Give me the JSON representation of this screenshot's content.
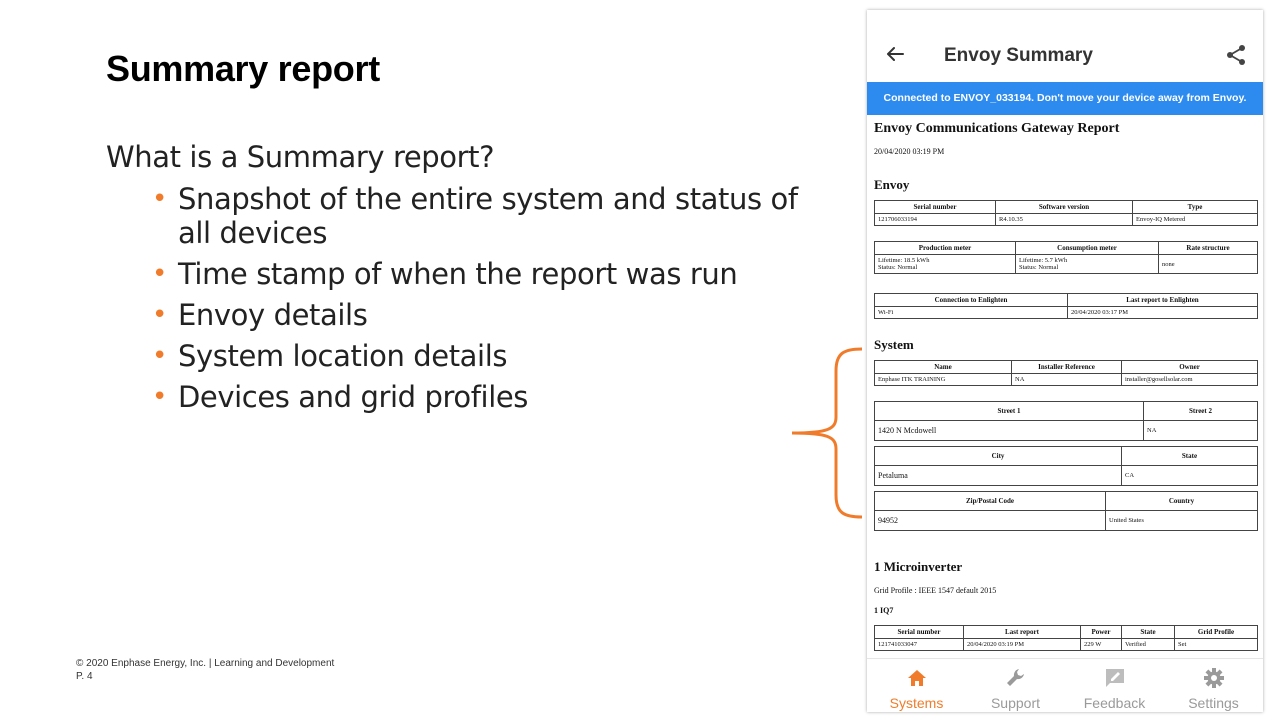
{
  "slide": {
    "title": "Summary report",
    "question": "What is a Summary report?",
    "bullets": [
      "Snapshot of the entire system and status of all devices",
      "Time stamp of when the report was run",
      "Envoy details",
      "System location details",
      "Devices and grid profiles"
    ],
    "footer_line1": "© 2020 Enphase Energy, Inc. | Learning and Development",
    "footer_line2": "P. 4",
    "colors": {
      "accent": "#f07c2b",
      "banner": "#2d8bf0"
    }
  },
  "app": {
    "title": "Envoy Summary",
    "back_icon": "arrow-left-icon",
    "share_icon": "share-icon",
    "banner": "Connected to ENVOY_033194. Don't move your device away from Envoy.",
    "report": {
      "title": "Envoy Communications Gateway Report",
      "date": "20/04/2020 03:19 PM",
      "envoy_heading": "Envoy",
      "envoy_table": {
        "headers": [
          "Serial number",
          "Software version",
          "Type"
        ],
        "row": [
          "121706033194",
          "R4.10.35",
          "Envoy-IQ Metered"
        ]
      },
      "meter_table": {
        "headers": [
          "Production meter",
          "Consumption meter",
          "Rate structure"
        ],
        "prod_l1": "Lifetime: 18.5 kWh",
        "prod_l2": "Status: Normal",
        "cons_l1": "Lifetime: 5.7 kWh",
        "cons_l2": "Status: Normal",
        "rate": "none"
      },
      "conn_table": {
        "headers": [
          "Connection to Enlighten",
          "Last report to Enlighten"
        ],
        "row": [
          "Wi-Fi",
          "20/04/2020 03:17 PM"
        ]
      },
      "system_heading": "System",
      "system_table": {
        "headers": [
          "Name",
          "Installer Reference",
          "Owner"
        ],
        "row": [
          "Enphase ITK TRAINING",
          "NA",
          "installer@gosellsolar.com"
        ]
      },
      "street_table": {
        "headers": [
          "Street 1",
          "Street 2"
        ],
        "row": [
          "1420 N Mcdowell",
          "NA"
        ]
      },
      "city_table": {
        "headers": [
          "City",
          "State"
        ],
        "row": [
          "Petaluma",
          "CA"
        ]
      },
      "zip_table": {
        "headers": [
          "Zip/Postal Code",
          "Country"
        ],
        "row": [
          "94952",
          "United States"
        ]
      },
      "micro_heading": "1 Microinverter",
      "grid_profile": "Grid Profile : IEEE 1547 default 2015",
      "model": "1 IQ7",
      "micro_table": {
        "headers": [
          "Serial number",
          "Last report",
          "Power",
          "State",
          "Grid Profile"
        ],
        "row": [
          "121741033047",
          "20/04/2020 03:19 PM",
          "229 W",
          "Verified",
          "Set"
        ]
      }
    },
    "nav": [
      {
        "label": "Systems",
        "icon": "home-icon",
        "active": true
      },
      {
        "label": "Support",
        "icon": "wrench-icon",
        "active": false
      },
      {
        "label": "Feedback",
        "icon": "feedback-icon",
        "active": false
      },
      {
        "label": "Settings",
        "icon": "gear-icon",
        "active": false
      }
    ]
  }
}
